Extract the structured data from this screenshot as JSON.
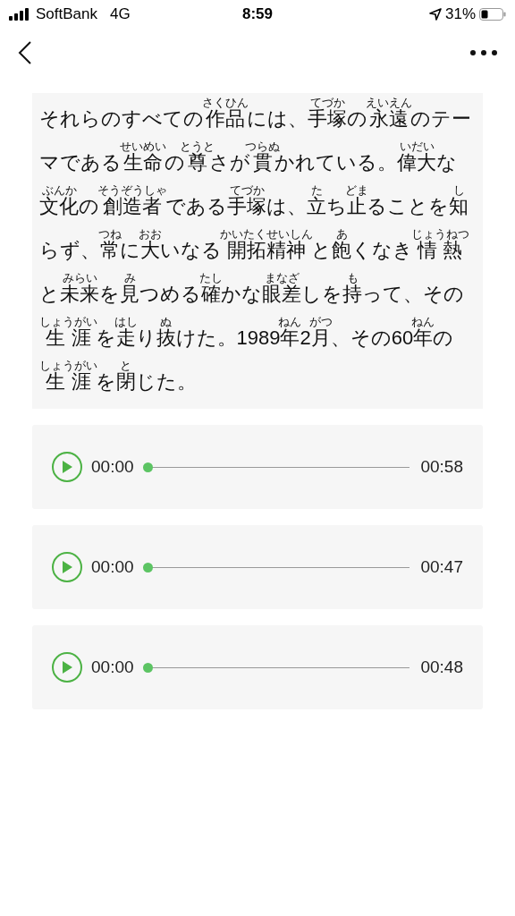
{
  "status_bar": {
    "carrier": "SoftBank",
    "network": "4G",
    "time": "8:59",
    "battery": "31%"
  },
  "passage": {
    "lines": [
      [
        {
          "t": "それらのすべての"
        },
        {
          "t": "作品",
          "r": "さくひん"
        },
        {
          "t": "には、"
        },
        {
          "t": "手塚",
          "r": "てづか"
        },
        {
          "t": "の"
        },
        {
          "t": "永遠",
          "r": "えいえん"
        },
        {
          "t": "のテー"
        }
      ],
      [
        {
          "t": "マである"
        },
        {
          "t": "生命",
          "r": "せいめい"
        },
        {
          "t": "の"
        },
        {
          "t": "尊",
          "r": "とうと"
        },
        {
          "t": "さが"
        },
        {
          "t": "貫",
          "r": "つらぬ"
        },
        {
          "t": "かれている。"
        },
        {
          "t": "偉大",
          "r": "いだい"
        },
        {
          "t": "な"
        }
      ],
      [
        {
          "t": "文化",
          "r": "ぶんか"
        },
        {
          "t": "の"
        },
        {
          "t": "創造者",
          "r": "そうぞうしゃ"
        },
        {
          "t": "である"
        },
        {
          "t": "手塚",
          "r": "てづか"
        },
        {
          "t": "は、"
        },
        {
          "t": "立",
          "r": "た"
        },
        {
          "t": "ち"
        },
        {
          "t": "止",
          "r": "どま"
        },
        {
          "t": "ることを"
        },
        {
          "t": "知",
          "r": "し"
        }
      ],
      [
        {
          "t": "らず、"
        },
        {
          "t": "常",
          "r": "つね"
        },
        {
          "t": "に"
        },
        {
          "t": "大",
          "r": "おお"
        },
        {
          "t": "いなる"
        },
        {
          "t": "開拓精神",
          "r": "かいたくせいしん"
        },
        {
          "t": "と"
        },
        {
          "t": "飽",
          "r": "あ"
        },
        {
          "t": "くなき"
        },
        {
          "t": "情 熱",
          "r": "じょうねつ"
        }
      ],
      [
        {
          "t": "と"
        },
        {
          "t": "未来",
          "r": "みらい"
        },
        {
          "t": "を"
        },
        {
          "t": "見",
          "r": "み"
        },
        {
          "t": "つめる"
        },
        {
          "t": "確",
          "r": "たし"
        },
        {
          "t": "かな"
        },
        {
          "t": "眼差",
          "r": "まなざ"
        },
        {
          "t": "しを"
        },
        {
          "t": "持",
          "r": "も"
        },
        {
          "t": "って、その"
        }
      ],
      [
        {
          "t": "生 涯",
          "r": "しょうがい"
        },
        {
          "t": "を"
        },
        {
          "t": "走",
          "r": "はし"
        },
        {
          "t": "り"
        },
        {
          "t": "抜",
          "r": "ぬ"
        },
        {
          "t": "けた。1989"
        },
        {
          "t": "年",
          "r": "ねん"
        },
        {
          "t": "2"
        },
        {
          "t": "月",
          "r": "がつ"
        },
        {
          "t": "、その60"
        },
        {
          "t": "年",
          "r": "ねん"
        },
        {
          "t": "の"
        }
      ],
      [
        {
          "t": "生 涯",
          "r": "しょうがい"
        },
        {
          "t": "を"
        },
        {
          "t": "閉",
          "r": "と"
        },
        {
          "t": "じた。"
        }
      ]
    ]
  },
  "audio_players": [
    {
      "current": "00:00",
      "duration": "00:58",
      "level": 0
    },
    {
      "current": "00:00",
      "duration": "00:47",
      "level": 0
    },
    {
      "current": "00:00",
      "duration": "00:48",
      "level": 0
    }
  ]
}
